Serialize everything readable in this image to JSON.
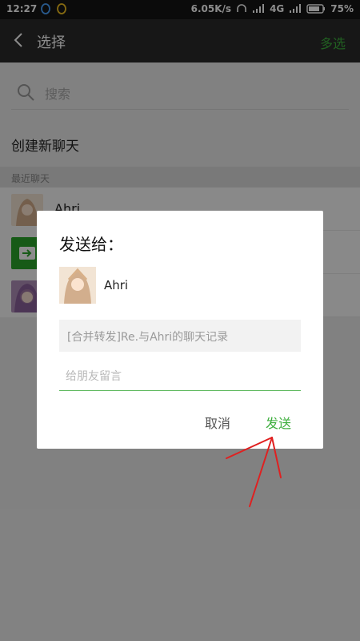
{
  "status_bar": {
    "time": "12:27",
    "network_speed": "6.05K/s",
    "network_type": "4G",
    "battery_percent": "75%"
  },
  "titlebar": {
    "title": "选择",
    "multi_select_label": "多选"
  },
  "search": {
    "placeholder": "搜索"
  },
  "create_chat": {
    "label": "创建新聊天"
  },
  "recent": {
    "header": "最近聊天",
    "items": [
      {
        "name": "Ahri"
      }
    ]
  },
  "dialog": {
    "title": "发送给：",
    "recipient_name": "Ahri",
    "preview_text": "[合并转发]Re.与Ahri的聊天记录",
    "message_placeholder": "给朋友留言",
    "cancel_label": "取消",
    "send_label": "发送"
  },
  "colors": {
    "accent_green": "#3cae3c",
    "titlebar_bg": "#2b2b2b",
    "annotation_red": "#e02020"
  }
}
